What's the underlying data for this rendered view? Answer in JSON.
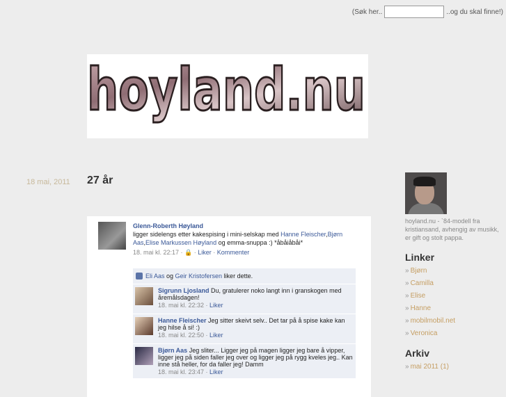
{
  "search": {
    "prefix": "(Søk her..",
    "suffix": "..og du skal finne!)",
    "value": ""
  },
  "logo": {
    "text": "hoyland.nu"
  },
  "post": {
    "date": "18 mai, 2011",
    "title": "27 år"
  },
  "facebook": {
    "author": "Glenn-Roberth Høyland",
    "status_parts": {
      "text1": "ligger sidelengs etter kakespising i mini-selskap med ",
      "link1": "Hanne Fleischer",
      "sep1": ",",
      "link2": "Bjørn Aas",
      "sep2": ",",
      "link3": "Elise Markussen Høyland",
      "text2": " og emma-snuppa :) *åbåiåbåi*"
    },
    "meta_time": "18. mai kl. 22:17 · ",
    "meta_like": "Liker",
    "meta_sep": " · ",
    "meta_comment": "Kommenter",
    "likes": {
      "name1": "Eli Aas",
      "and": " og ",
      "name2": "Geir Kristofersen",
      "suffix": " liker dette."
    },
    "comments": [
      {
        "author": "Sigrunn Ljosland",
        "text": " Du, gratulerer noko langt inn i granskogen med åremålsdagen!",
        "time": "18. mai kl. 22:32 · ",
        "like": "Liker"
      },
      {
        "author": "Hanne Fleischer",
        "text": " Jeg sitter skeivt selv.. Det tar på å spise kake kan jeg hilse å si! :)",
        "time": "18. mai kl. 22:50 · ",
        "like": "Liker"
      },
      {
        "author": "Bjørn Aas",
        "text": " Jeg sliter... Ligger jeg på magen ligger jeg bare å vipper, ligger jeg på siden faller jeg over og ligger jeg på rygg kveles jeg.. Kan inne stå heller, for da faller jeg! Damm",
        "time": "18. mai kl. 23:47 · ",
        "like": "Liker"
      }
    ]
  },
  "sidebar": {
    "description": "hoyland.nu - `84-modell fra kristiansand, avhengig av musikk, er gift og stolt pappa.",
    "links_heading": "Linker",
    "links": [
      "Bjørn",
      "Camilla",
      "Elise",
      "Hanne",
      "mobilmobil.net",
      "Veronica"
    ],
    "archive_heading": "Arkiv",
    "archive": [
      "mai 2011 (1)"
    ]
  },
  "colors": {
    "background": "#ededed",
    "link": "#c59e62",
    "fb_blue": "#3b5998",
    "date": "#c7b89a"
  }
}
